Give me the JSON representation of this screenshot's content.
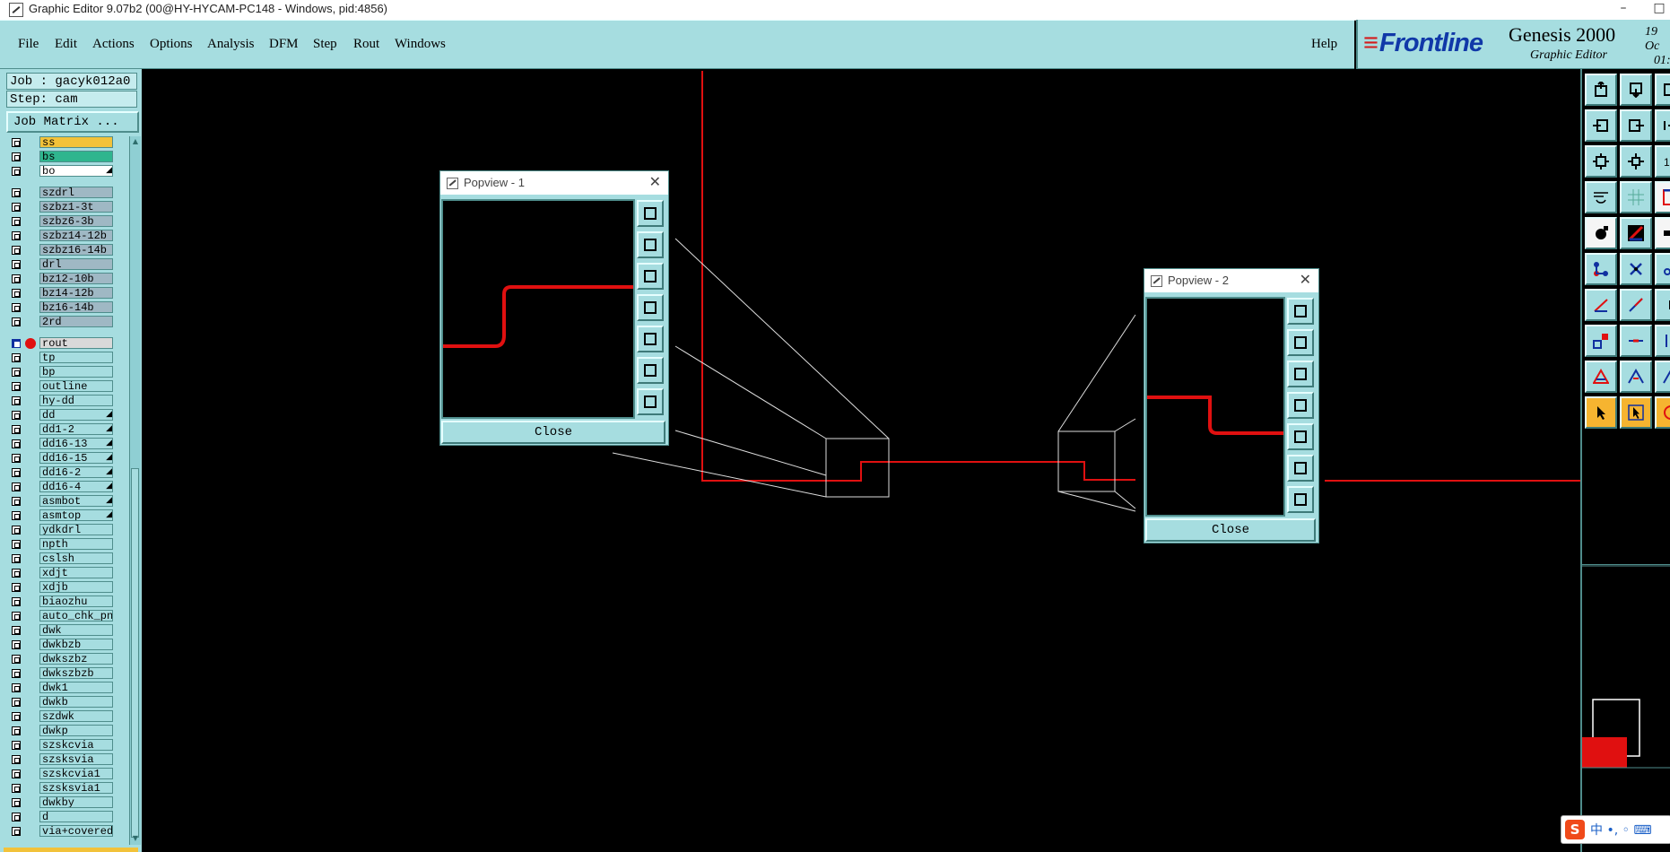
{
  "window": {
    "title": "Graphic Editor 9.07b2 (00@HY-HYCAM-PC148 - Windows, pid:4856)",
    "minimize": "–",
    "maximize": "□"
  },
  "menu": [
    {
      "label": "File"
    },
    {
      "label": "Edit"
    },
    {
      "label": "Actions"
    },
    {
      "label": "Options"
    },
    {
      "label": "Analysis"
    },
    {
      "label": "DFM"
    },
    {
      "label": "Step"
    },
    {
      "label": "Rout"
    },
    {
      "label": "Windows"
    }
  ],
  "help": "Help",
  "brand": {
    "logo": "Frontline",
    "product": "Genesis 2000",
    "subtitle": "Graphic Editor",
    "date_line1": "19 Oc",
    "date_line2": "01:"
  },
  "job": {
    "job_label": "Job : gacyk012a0",
    "step_label": "Step: cam",
    "matrix_button": "Job Matrix ..."
  },
  "layers": [
    {
      "name": "ss",
      "color": "yellow"
    },
    {
      "name": "bs",
      "color": "green"
    },
    {
      "name": "bo",
      "color": "white",
      "flag": "◢"
    },
    {
      "name": "szdrl",
      "color": "grey"
    },
    {
      "name": "szbz1-3t",
      "color": "grey"
    },
    {
      "name": "szbz6-3b",
      "color": "grey"
    },
    {
      "name": "szbz14-12b",
      "color": "grey"
    },
    {
      "name": "szbz16-14b",
      "color": "grey"
    },
    {
      "name": "drl",
      "color": "grey"
    },
    {
      "name": "bz12-10b",
      "color": "grey"
    },
    {
      "name": "bz14-12b",
      "color": "grey"
    },
    {
      "name": "bz16-14b",
      "color": "grey"
    },
    {
      "name": "2rd",
      "color": "grey"
    },
    {
      "name": "rout",
      "color": "active",
      "selected": true
    },
    {
      "name": "tp",
      "color": "teal"
    },
    {
      "name": "bp",
      "color": "teal"
    },
    {
      "name": "outline",
      "color": "teal"
    },
    {
      "name": "hy-dd",
      "color": "teal"
    },
    {
      "name": "dd",
      "color": "teal",
      "flag": "◢"
    },
    {
      "name": "dd1-2",
      "color": "teal",
      "flag": "◢"
    },
    {
      "name": "dd16-13",
      "color": "teal",
      "flag": "◢"
    },
    {
      "name": "dd16-15",
      "color": "teal",
      "flag": "◢"
    },
    {
      "name": "dd16-2",
      "color": "teal",
      "flag": "◢"
    },
    {
      "name": "dd16-4",
      "color": "teal",
      "flag": "◢"
    },
    {
      "name": "asmbot",
      "color": "teal",
      "flag": "◢"
    },
    {
      "name": "asmtop",
      "color": "teal",
      "flag": "◢"
    },
    {
      "name": "ydkdrl",
      "color": "teal"
    },
    {
      "name": "npth",
      "color": "teal"
    },
    {
      "name": "cslsh",
      "color": "teal"
    },
    {
      "name": "xdjt",
      "color": "teal"
    },
    {
      "name": "xdjb",
      "color": "teal"
    },
    {
      "name": "biaozhu",
      "color": "teal"
    },
    {
      "name": "auto_chk_pn",
      "color": "teal"
    },
    {
      "name": "dwk",
      "color": "teal"
    },
    {
      "name": "dwkbzb",
      "color": "teal"
    },
    {
      "name": "dwkszbz",
      "color": "teal"
    },
    {
      "name": "dwkszbzb",
      "color": "teal"
    },
    {
      "name": "dwk1",
      "color": "teal"
    },
    {
      "name": "dwkb",
      "color": "teal"
    },
    {
      "name": "szdwk",
      "color": "teal"
    },
    {
      "name": "dwkp",
      "color": "teal"
    },
    {
      "name": "szskcvia",
      "color": "teal"
    },
    {
      "name": "szsksvia",
      "color": "teal"
    },
    {
      "name": "szskcvia1",
      "color": "teal"
    },
    {
      "name": "szsksvia1",
      "color": "teal"
    },
    {
      "name": "dwkby",
      "color": "teal"
    },
    {
      "name": "d",
      "color": "teal"
    },
    {
      "name": "via+covered",
      "color": "teal"
    }
  ],
  "popviews": [
    {
      "title": "Popview - 1",
      "close": "Close",
      "close_x": "✕"
    },
    {
      "title": "Popview - 2",
      "close": "Close",
      "close_x": "✕"
    }
  ],
  "colors": {
    "panel": "#a6dde0",
    "panel_dark": "#4f8d8c",
    "rout_line": "#e01010",
    "canvas": "#000000"
  },
  "ime": {
    "logo": "S",
    "text": "中 •, ◦ ⌨"
  }
}
